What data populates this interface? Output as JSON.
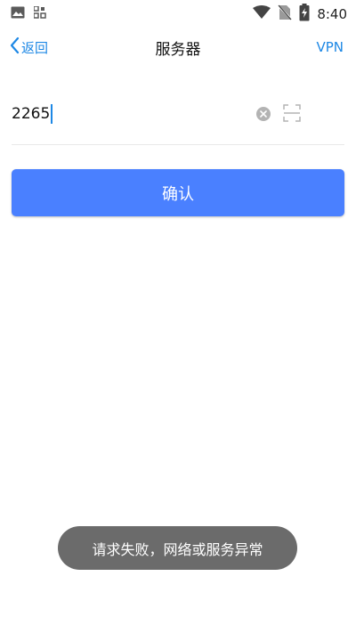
{
  "status_bar": {
    "time": "8:40",
    "icons": [
      "image-icon",
      "qr-app-icon",
      "wifi-icon",
      "no-sim-icon",
      "battery-charging-icon"
    ]
  },
  "header": {
    "back_label": "返回",
    "title": "服务器",
    "vpn_label": "VPN"
  },
  "server_input": {
    "value": "2265",
    "clear_icon": "clear-icon",
    "scan_icon": "scan-icon"
  },
  "confirm_button": {
    "label": "确认"
  },
  "toast": {
    "message": "请求失败，网络或服务异常"
  },
  "colors": {
    "accent": "#1e88e5",
    "button": "#4a80ff",
    "toast_bg": "#6b6b6b",
    "divider": "#e8e8e8"
  }
}
